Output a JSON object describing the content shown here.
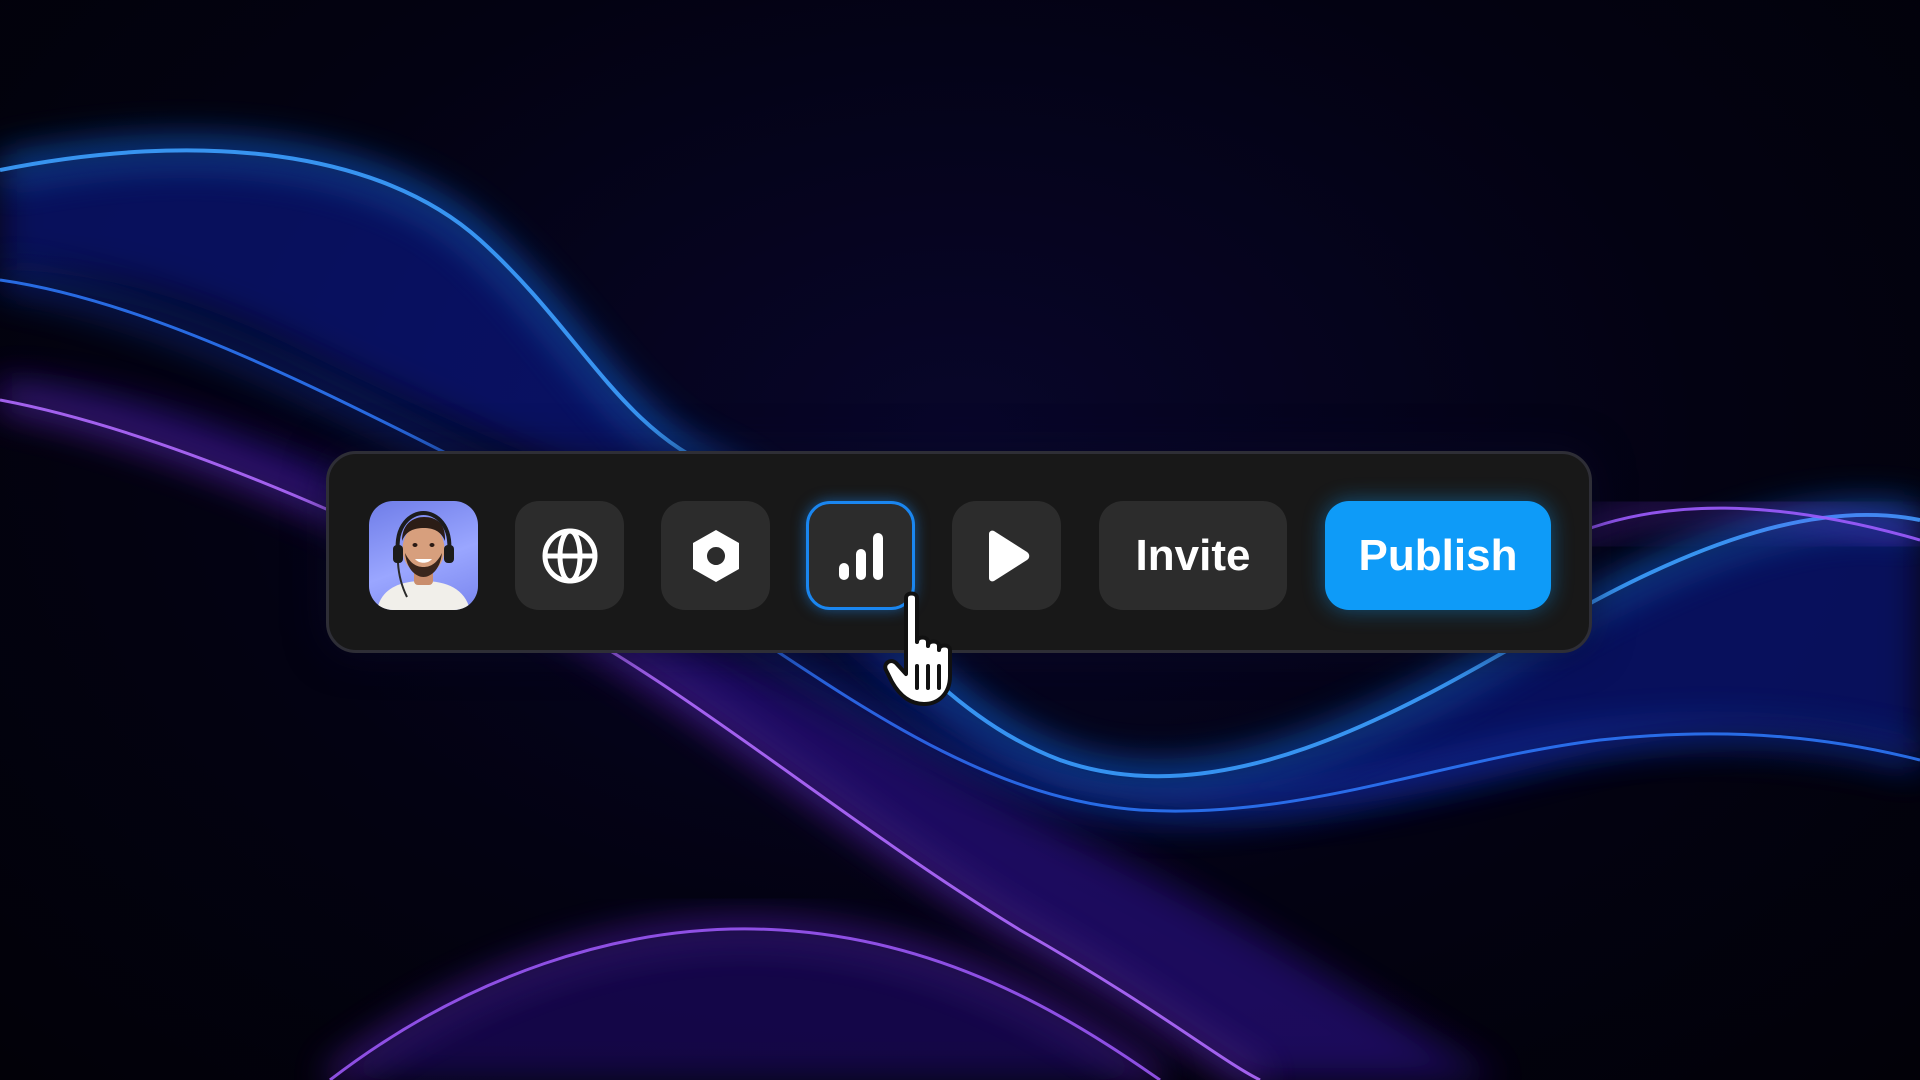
{
  "toolbar": {
    "avatar": {
      "icon": "user-avatar-photo"
    },
    "buttons": [
      {
        "id": "globe",
        "icon": "globe-icon"
      },
      {
        "id": "settings",
        "icon": "hexagon-settings-icon"
      },
      {
        "id": "stats",
        "icon": "bar-chart-icon",
        "state": "hovered"
      },
      {
        "id": "play",
        "icon": "play-icon"
      }
    ],
    "invite_label": "Invite",
    "publish_label": "Publish"
  },
  "cursor": {
    "icon": "hand-pointer-cursor"
  },
  "colors": {
    "accent": "#0e9bf8",
    "hover_border": "#1a86f0",
    "toolbar_bg": "#181818",
    "button_bg": "#2c2c2c",
    "wave_blue": "#1f6bff",
    "wave_purple": "#8a3cff"
  }
}
